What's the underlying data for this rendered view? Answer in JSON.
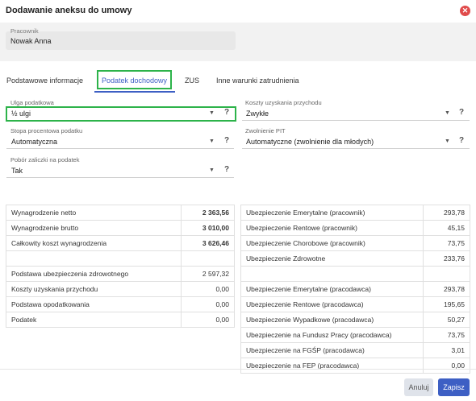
{
  "dialog": {
    "title": "Dodawanie aneksu do umowy",
    "close_icon": "close-icon"
  },
  "employee": {
    "label": "Pracownik",
    "value": "Nowak Anna"
  },
  "tabs": [
    {
      "label": "Podstawowe informacje",
      "active": false
    },
    {
      "label": "Podatek dochodowy",
      "active": true
    },
    {
      "label": "ZUS",
      "active": false
    },
    {
      "label": "Inne warunki zatrudnienia",
      "active": false
    }
  ],
  "form": {
    "ulga": {
      "label": "Ulga podatkowa",
      "value": "½ ulgi"
    },
    "koszty": {
      "label": "Koszty uzyskania przychodu",
      "value": "Zwykłe"
    },
    "stopa": {
      "label": "Stopa procentowa podatku",
      "value": "Automatyczna"
    },
    "zwolnienie": {
      "label": "Zwolnienie PIT",
      "value": "Automatyczne (zwolnienie dla młodych)"
    },
    "pobor": {
      "label": "Pobór zaliczki na podatek",
      "value": "Tak"
    },
    "help_glyph": "?"
  },
  "left_table": {
    "group1": [
      {
        "label": "Wynagrodzenie netto",
        "value": "2 363,56"
      },
      {
        "label": "Wynagrodzenie brutto",
        "value": "3 010,00"
      },
      {
        "label": "Całkowity koszt wynagrodzenia",
        "value": "3 626,46"
      }
    ],
    "group2": [
      {
        "label": "Podstawa ubezpieczenia zdrowotnego",
        "value": "2 597,32"
      },
      {
        "label": "Koszty uzyskania przychodu",
        "value": "0,00"
      },
      {
        "label": "Podstawa opodatkowania",
        "value": "0,00"
      },
      {
        "label": "Podatek",
        "value": "0,00"
      }
    ]
  },
  "right_table": {
    "group1": [
      {
        "label": "Ubezpieczenie Emerytalne (pracownik)",
        "value": "293,78"
      },
      {
        "label": "Ubezpieczenie Rentowe (pracownik)",
        "value": "45,15"
      },
      {
        "label": "Ubezpieczenie Chorobowe (pracownik)",
        "value": "73,75"
      },
      {
        "label": "Ubezpieczenie Zdrowotne",
        "value": "233,76"
      }
    ],
    "group2": [
      {
        "label": "Ubezpieczenie Emerytalne (pracodawca)",
        "value": "293,78"
      },
      {
        "label": "Ubezpieczenie Rentowe (pracodawca)",
        "value": "195,65"
      },
      {
        "label": "Ubezpieczenie Wypadkowe (pracodawca)",
        "value": "50,27"
      },
      {
        "label": "Ubezpieczenie na Fundusz Pracy (pracodawca)",
        "value": "73,75"
      },
      {
        "label": "Ubezpieczenie na FGŚP (pracodawca)",
        "value": "3,01"
      },
      {
        "label": "Ubezpieczenie na FEP (pracodawca)",
        "value": "0,00"
      }
    ]
  },
  "footer": {
    "cancel_label": "Anuluj",
    "save_label": "Zapisz"
  },
  "colors": {
    "accent": "#3d5fc4",
    "highlight": "#2db34a",
    "close": "#e04b4b"
  }
}
